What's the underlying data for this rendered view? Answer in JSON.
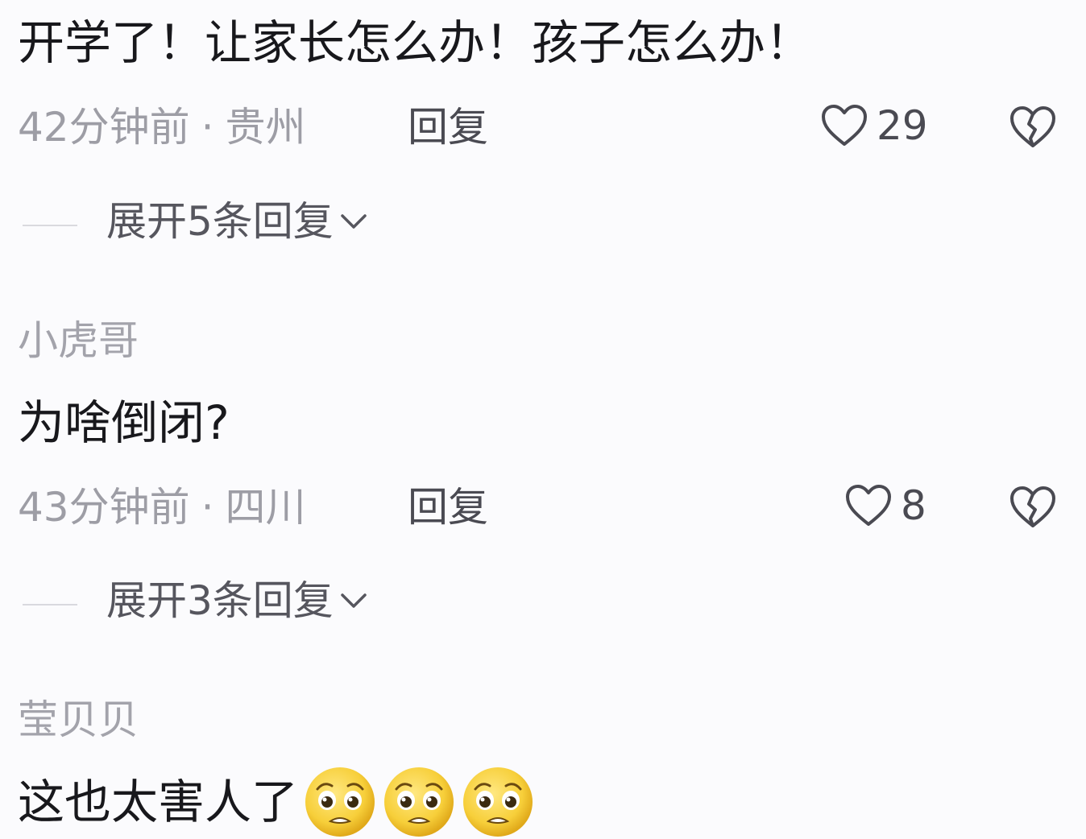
{
  "comments": [
    {
      "text": "开学了！让家长怎么办！孩子怎么办！",
      "time": "42分钟前",
      "location": "贵州",
      "reply_label": "回复",
      "likes": "29",
      "expand_label": "展开5条回复"
    },
    {
      "username": "小虎哥",
      "text": "为啥倒闭?",
      "time": "43分钟前",
      "location": "四川",
      "reply_label": "回复",
      "likes": "8",
      "expand_label": "展开3条回复"
    },
    {
      "username": "莹贝贝",
      "text": "这也太害人了",
      "emojis": [
        "pleading-face-emoji",
        "pleading-face-emoji",
        "pleading-face-emoji"
      ]
    }
  ],
  "separator": "·",
  "icons": {
    "like": "heart-outline-icon",
    "dislike": "broken-heart-icon",
    "expand": "chevron-down-icon"
  },
  "colors": {
    "background": "#fbfbfd",
    "text_primary": "#18181c",
    "text_secondary": "#9d9da5",
    "emoji_yellow": "#f7cf3a"
  }
}
